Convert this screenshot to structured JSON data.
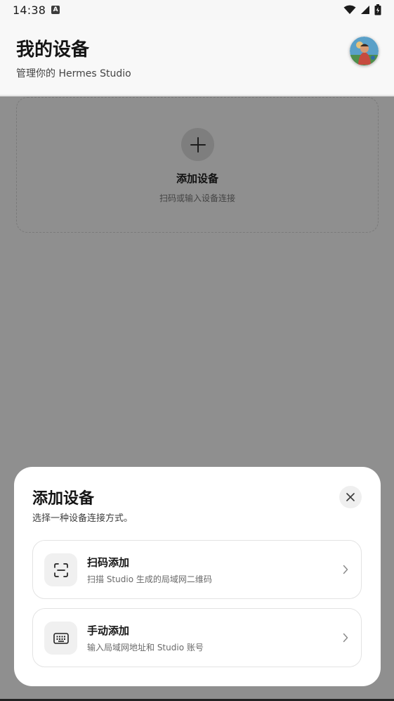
{
  "status_bar": {
    "time": "14:38",
    "notification_icon_letter": "A",
    "icons": [
      "wifi-icon",
      "signal-icon",
      "battery-icon"
    ]
  },
  "header": {
    "title": "我的设备",
    "subtitle": "管理你的 Hermes Studio",
    "avatar_icon": "avatar"
  },
  "add_card": {
    "title": "添加设备",
    "subtitle": "扫码或输入设备连接",
    "icon": "plus-icon"
  },
  "sheet": {
    "title": "添加设备",
    "subtitle": "选择一种设备连接方式。",
    "close_icon": "close-icon",
    "options": [
      {
        "title": "扫码添加",
        "description": "扫描 Studio 生成的局域网二维码",
        "icon": "scan-icon"
      },
      {
        "title": "手动添加",
        "description": "输入局域网地址和 Studio 账号",
        "icon": "keyboard-icon"
      }
    ]
  },
  "colors": {
    "scrim": "#8f8f8f",
    "sheet_background": "#ffffff",
    "header_background": "#f8f8f8",
    "icon_tile": "#f0f0f0"
  }
}
